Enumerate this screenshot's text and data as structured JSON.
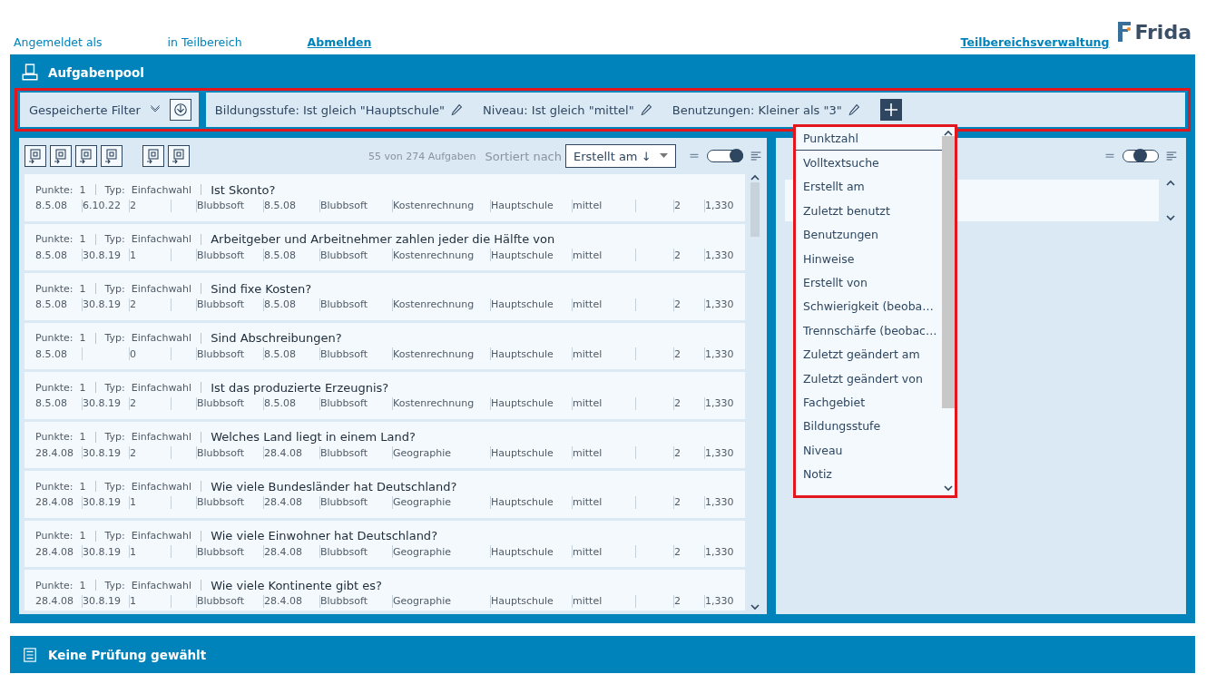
{
  "header": {
    "logged_in_label": "Angemeldet als",
    "area_label": "in Teilbereich",
    "logout_link": "Abmelden",
    "admin_link": "Teilbereichsverwaltung",
    "logo_text": "Frida"
  },
  "pool": {
    "title": "Aufgabenpool"
  },
  "filter_bar": {
    "highlighted": true,
    "saved_filters": "Gespeicherte Filter",
    "filters": [
      {
        "label": "Bildungsstufe: Ist gleich \"Hauptschule\""
      },
      {
        "label": "Niveau: Ist gleich \"mittel\""
      },
      {
        "label": "Benutzungen: Kleiner als \"3\""
      }
    ]
  },
  "task_list": {
    "count": "55 von 274 Aufgaben",
    "sort_label": "Sortiert nach",
    "sort_value": "Erstellt am ↓",
    "view_toggle": {
      "level": 1
    },
    "rows": [
      {
        "points_label": "Punkte:",
        "points": "1",
        "type_label": "Typ:",
        "type": "Einfachwahl",
        "title": "Ist Skonto?",
        "meta": {
          "created": "8.5.08",
          "last_used": "6.10.22",
          "uses": "2",
          "author": "Blubbsoft",
          "changed": "8.5.08",
          "changed_by": "Blubbsoft",
          "subject": "Kostenrechnung",
          "school": "Hauptschule",
          "level": "mittel",
          "col_a": "2",
          "col_b": "1,330"
        }
      },
      {
        "points_label": "Punkte:",
        "points": "1",
        "type_label": "Typ:",
        "type": "Einfachwahl",
        "title": "Arbeitgeber und Arbeitnehmer zahlen jeder die Hälfte von",
        "meta": {
          "created": "8.5.08",
          "last_used": "30.8.19",
          "uses": "1",
          "author": "Blubbsoft",
          "changed": "8.5.08",
          "changed_by": "Blubbsoft",
          "subject": "Kostenrechnung",
          "school": "Hauptschule",
          "level": "mittel",
          "col_a": "2",
          "col_b": "1,330"
        }
      },
      {
        "points_label": "Punkte:",
        "points": "1",
        "type_label": "Typ:",
        "type": "Einfachwahl",
        "title": "Sind fixe Kosten?",
        "meta": {
          "created": "8.5.08",
          "last_used": "30.8.19",
          "uses": "2",
          "author": "Blubbsoft",
          "changed": "8.5.08",
          "changed_by": "Blubbsoft",
          "subject": "Kostenrechnung",
          "school": "Hauptschule",
          "level": "mittel",
          "col_a": "2",
          "col_b": "1,330"
        }
      },
      {
        "points_label": "Punkte:",
        "points": "1",
        "type_label": "Typ:",
        "type": "Einfachwahl",
        "title": "Sind Abschreibungen?",
        "meta": {
          "created": "8.5.08",
          "uses": "0",
          "author": "Blubbsoft",
          "changed": "8.5.08",
          "changed_by": "Blubbsoft",
          "subject": "Kostenrechnung",
          "school": "Hauptschule",
          "level": "mittel",
          "col_a": "2",
          "col_b": "1,330"
        }
      },
      {
        "points_label": "Punkte:",
        "points": "1",
        "type_label": "Typ:",
        "type": "Einfachwahl",
        "title": "Ist das produzierte Erzeugnis?",
        "meta": {
          "created": "8.5.08",
          "last_used": "30.8.19",
          "uses": "2",
          "author": "Blubbsoft",
          "changed": "8.5.08",
          "changed_by": "Blubbsoft",
          "subject": "Kostenrechnung",
          "school": "Hauptschule",
          "level": "mittel",
          "col_a": "2",
          "col_b": "1,330"
        }
      },
      {
        "points_label": "Punkte:",
        "points": "1",
        "type_label": "Typ:",
        "type": "Einfachwahl",
        "title": "Welches Land liegt in einem Land?",
        "meta": {
          "created": "28.4.08",
          "last_used": "30.8.19",
          "uses": "2",
          "author": "Blubbsoft",
          "changed": "28.4.08",
          "changed_by": "Blubbsoft",
          "subject": "Geographie",
          "school": "Hauptschule",
          "level": "mittel",
          "col_a": "2",
          "col_b": "1,330"
        }
      },
      {
        "points_label": "Punkte:",
        "points": "1",
        "type_label": "Typ:",
        "type": "Einfachwahl",
        "title": "Wie viele Bundesländer hat Deutschland?",
        "meta": {
          "created": "28.4.08",
          "last_used": "30.8.19",
          "uses": "1",
          "author": "Blubbsoft",
          "changed": "28.4.08",
          "changed_by": "Blubbsoft",
          "subject": "Geographie",
          "school": "Hauptschule",
          "level": "mittel",
          "col_a": "2",
          "col_b": "1,330"
        }
      },
      {
        "points_label": "Punkte:",
        "points": "1",
        "type_label": "Typ:",
        "type": "Einfachwahl",
        "title": "Wie viele Einwohner hat Deutschland?",
        "meta": {
          "created": "28.4.08",
          "last_used": "30.8.19",
          "uses": "1",
          "author": "Blubbsoft",
          "changed": "28.4.08",
          "changed_by": "Blubbsoft",
          "subject": "Geographie",
          "school": "Hauptschule",
          "level": "mittel",
          "col_a": "2",
          "col_b": "1,330"
        }
      },
      {
        "points_label": "Punkte:",
        "points": "1",
        "type_label": "Typ:",
        "type": "Einfachwahl",
        "title": "Wie viele Kontinente gibt es?",
        "meta": {
          "created": "28.4.08",
          "last_used": "30.8.19",
          "uses": "1",
          "author": "Blubbsoft",
          "changed": "28.4.08",
          "changed_by": "Blubbsoft",
          "subject": "Geographie",
          "school": "Hauptschule",
          "level": "mittel",
          "col_a": "2",
          "col_b": "1,330"
        }
      }
    ]
  },
  "detail_panel": {
    "view_toggle": {
      "level": 0.5
    }
  },
  "filter_menu": {
    "highlighted": true,
    "items": [
      {
        "label": "Punktzahl",
        "selected": true
      },
      {
        "label": "Volltextsuche",
        "selected": false
      },
      {
        "label": "Erstellt am",
        "selected": false
      },
      {
        "label": "Zuletzt benutzt",
        "selected": false
      },
      {
        "label": "Benutzungen",
        "selected": false
      },
      {
        "label": "Hinweise",
        "selected": false
      },
      {
        "label": "Erstellt von",
        "selected": false
      },
      {
        "label": "Schwierigkeit (beoba…",
        "selected": false
      },
      {
        "label": "Trennschärfe (beobac…",
        "selected": false
      },
      {
        "label": "Zuletzt geändert am",
        "selected": false
      },
      {
        "label": "Zuletzt geändert von",
        "selected": false
      },
      {
        "label": "Fachgebiet",
        "selected": false
      },
      {
        "label": "Bildungsstufe",
        "selected": false
      },
      {
        "label": "Niveau",
        "selected": false
      },
      {
        "label": "Notiz",
        "selected": false
      }
    ]
  },
  "footer": {
    "title": "Keine Prüfung gewählt"
  }
}
